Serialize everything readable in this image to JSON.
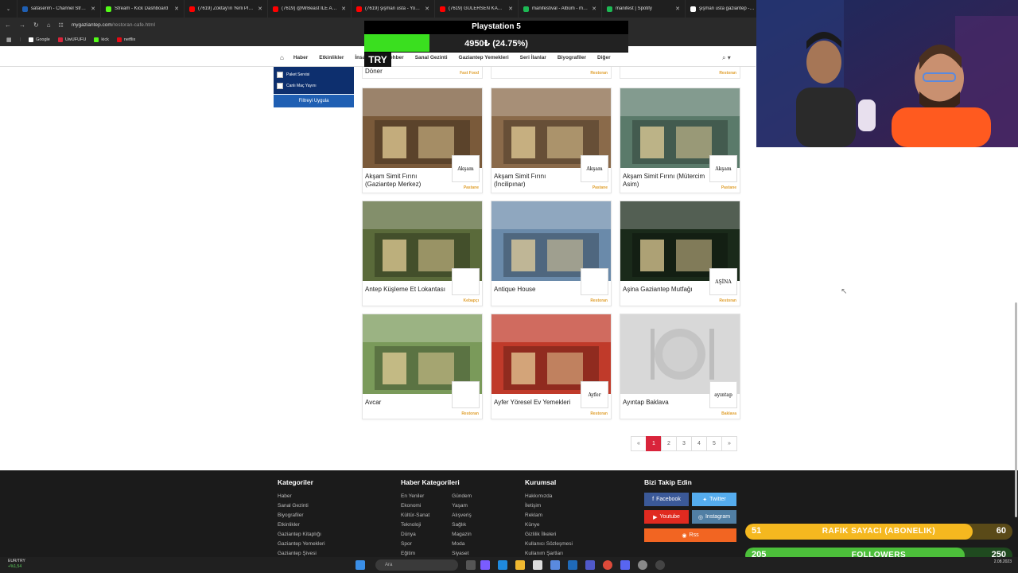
{
  "browser": {
    "tabs": [
      {
        "label": "safaserim - Channel Strea...",
        "color": "#1f5fb3"
      },
      {
        "label": "Stream - Kick Dashboard",
        "color": "#53fc18"
      },
      {
        "label": "(7619) Zoktay'ın Yerli Plak...",
        "color": "#ff0000"
      },
      {
        "label": "(7619) @MrBeast İLE AFRİ...",
        "color": "#ff0000"
      },
      {
        "label": "(7619) şişman usta - YouT...",
        "color": "#ff0000"
      },
      {
        "label": "(7619) GÜLERSEN KAYBE...",
        "color": "#ff0000"
      },
      {
        "label": "manifestival - Albüm - ma...",
        "color": "#1db954"
      },
      {
        "label": "manifest | Spotify",
        "color": "#1db954"
      },
      {
        "label": "şişman usta gaziantep - G...",
        "color": "#ffffff"
      }
    ],
    "url_domain": "mygaziantep.com",
    "url_path": "/restoran-cafe.html",
    "bookmarks": [
      {
        "label": "Google",
        "color": "#ffffff"
      },
      {
        "label": "UwUFUFU",
        "color": "#d9243b"
      },
      {
        "label": "kick",
        "color": "#53fc18"
      },
      {
        "label": "netflix",
        "color": "#e50914"
      }
    ]
  },
  "site": {
    "nav": [
      "Haber",
      "Etkinlikler",
      "İnsanlar",
      "Rehber",
      "Sanal Gezinti",
      "Gaziantep Yemekleri",
      "Seri İlanlar",
      "Biyografiler",
      "Diğer"
    ],
    "sidebar": {
      "checkboxes": [
        "Paket Servisi",
        "Canlı Maç Yayını"
      ],
      "apply": "Filtreyi Uygula"
    },
    "partial_row": [
      {
        "name": "Döner",
        "category": "Fast Food"
      },
      {
        "name": "",
        "category": "Restoran"
      },
      {
        "name": "",
        "category": "Restoran"
      }
    ],
    "cards": [
      {
        "name": "Akşam Simit Fırını (Gaziantep Merkez)",
        "category": "Pastane",
        "logo": "Akşam"
      },
      {
        "name": "Akşam Simit Fırını (İncilipınar)",
        "category": "Pastane",
        "logo": "Akşam"
      },
      {
        "name": "Akşam Simit Fırını (Mütercim Asim)",
        "category": "Pastane",
        "logo": "Akşam"
      },
      {
        "name": "Antep Küşleme Et Lokantası",
        "category": "Kebapçı",
        "logo": ""
      },
      {
        "name": "Antique House",
        "category": "Restoran",
        "logo": ""
      },
      {
        "name": "Aşina Gaziantep Mutfağı",
        "category": "Restoran",
        "logo": "AŞİNA"
      },
      {
        "name": "Avcar",
        "category": "Restoran",
        "logo": ""
      },
      {
        "name": "Ayfer Yöresel Ev Yemekleri",
        "category": "Restoran",
        "logo": "Ayfer"
      },
      {
        "name": "Ayıntap Baklava",
        "category": "Baklava",
        "logo": "ayıntap"
      }
    ],
    "pager": [
      "«",
      "1",
      "2",
      "3",
      "4",
      "5",
      "»"
    ],
    "pager_active": "1"
  },
  "footer": {
    "col1": {
      "title": "Kategoriler",
      "items": [
        "Haber",
        "Sanal Gezinti",
        "Biyografiler",
        "Etkinlikler",
        "Gaziantep Kitaplığı",
        "Gaziantep Yemekleri",
        "Gaziantep Şivesi"
      ]
    },
    "col2": {
      "title": "Haber Kategorileri",
      "items_a": [
        "En Yeniler",
        "Ekonomi",
        "Kültür-Sanat",
        "Teknoloji",
        "Dünya",
        "Spor",
        "Eğitim"
      ],
      "items_b": [
        "Gündem",
        "Yaşam",
        "Alışveriş",
        "Sağlık",
        "Magazin",
        "Moda",
        "Siyaset"
      ]
    },
    "col3": {
      "title": "Kurumsal",
      "items": [
        "Hakkımızda",
        "İletişim",
        "Reklam",
        "Künye",
        "Gizlilik İlkeleri",
        "Kullanıcı Sözleşmesi",
        "Kullanım Şartları"
      ]
    },
    "col4": {
      "title": "Bizi Takip Edin",
      "facebook": "Facebook",
      "twitter": "Twitter",
      "youtube": "Youtube",
      "instagram": "Instagram",
      "rss": "Rss"
    }
  },
  "overlay": {
    "ps_title": "Playstation 5",
    "ps_progress": "4950₺ (24.75%)",
    "ps_fraction": 0.2475,
    "try_label": "TRY",
    "sub_counter": {
      "left": "51",
      "label": "RAFIK SAYACI (ABONELIK)",
      "right": "60",
      "fraction": 0.85
    },
    "follow_counter": {
      "left": "205",
      "label": "FOLLOWERS",
      "right": "250",
      "fraction": 0.82
    }
  },
  "taskbar": {
    "pair": "EUR/TRY",
    "change": "+%1,54",
    "search": "Ara",
    "date": "2.08.2023"
  },
  "colors": {
    "accent_red": "#d9243b",
    "category_gold": "#e0a030",
    "filter_blue": "#0d2f6e",
    "progress_green": "#3adf1f"
  }
}
